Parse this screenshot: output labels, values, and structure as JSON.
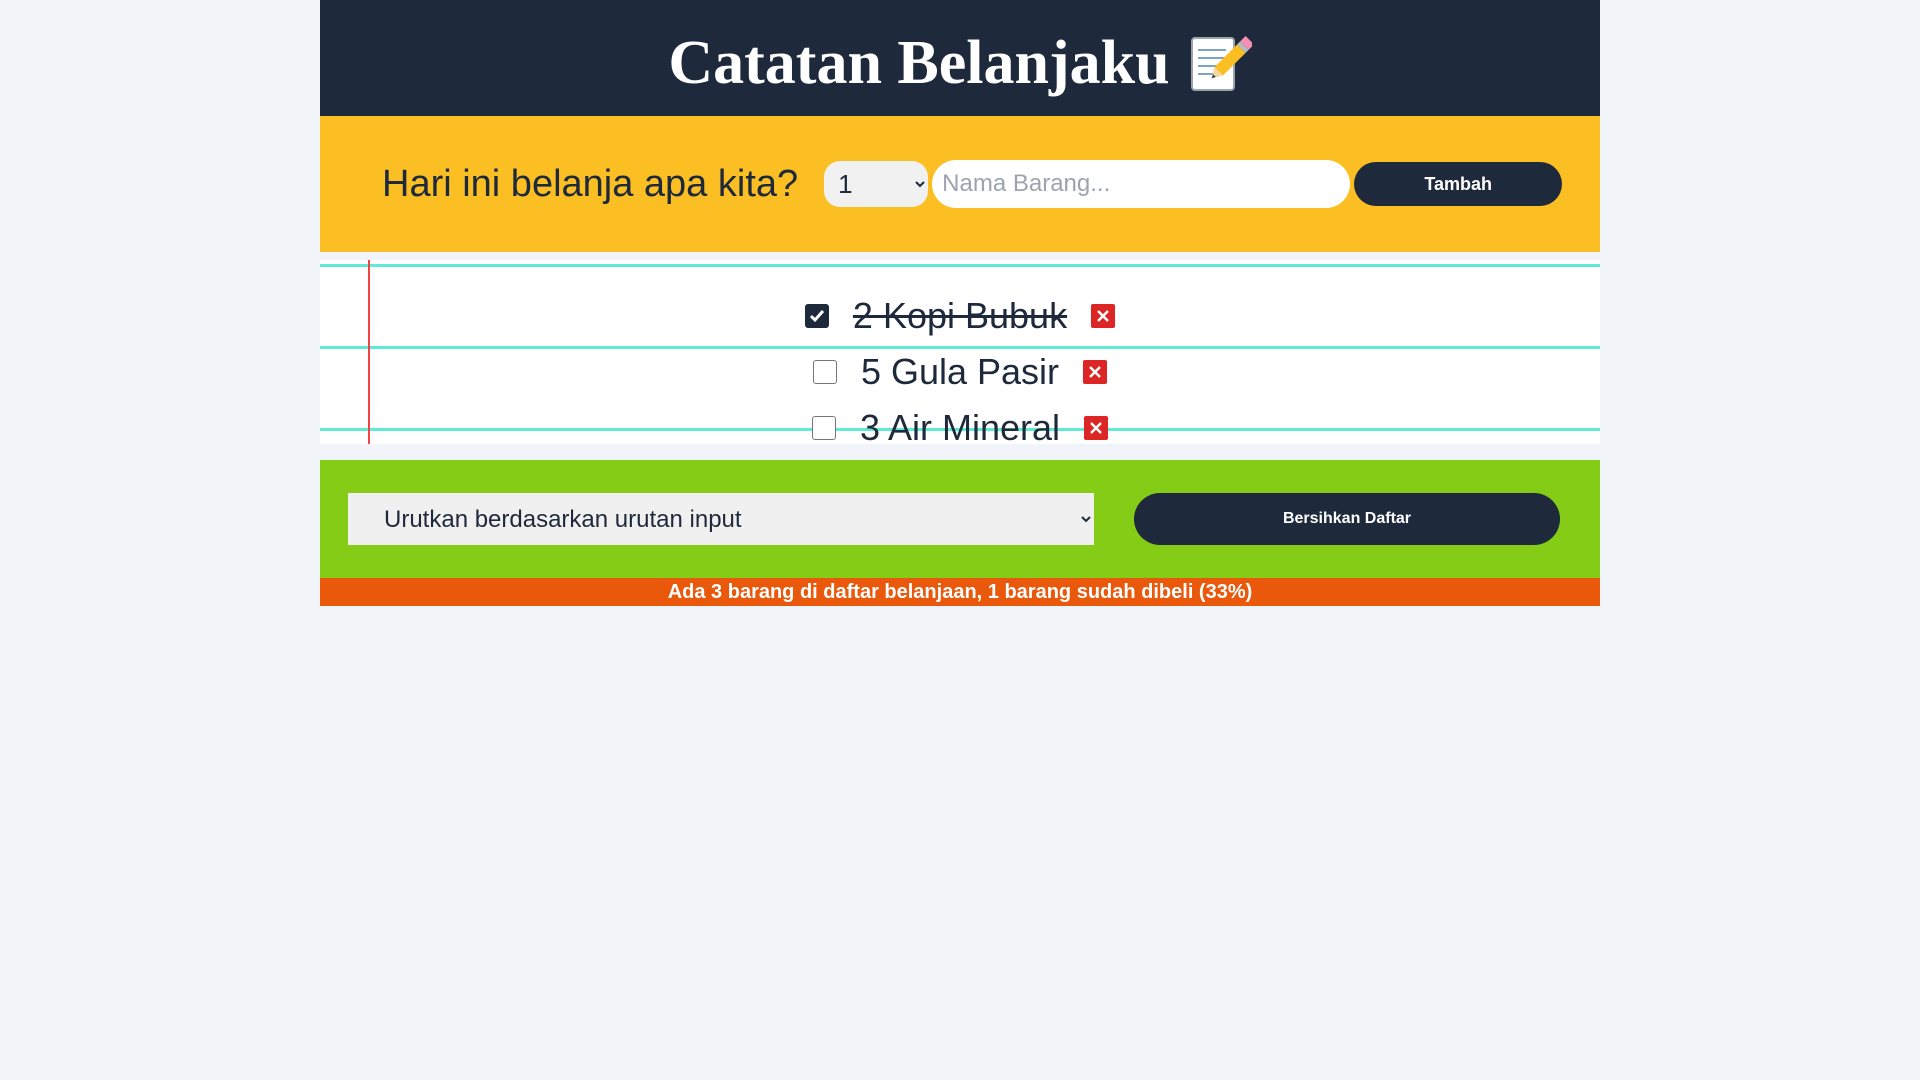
{
  "header": {
    "title": "Catatan Belanjaku",
    "emoji_icon": "memo-pencil-icon"
  },
  "form": {
    "question": "Hari ini belanja apa kita?",
    "quantity_selected": "1",
    "name_placeholder": "Nama Barang...",
    "add_label": "Tambah"
  },
  "items": [
    {
      "quantity": "2",
      "name": "Kopi Bubuk",
      "text": "2 Kopi Bubuk",
      "checked": true
    },
    {
      "quantity": "5",
      "name": "Gula Pasir",
      "text": "5 Gula Pasir",
      "checked": false
    },
    {
      "quantity": "3",
      "name": "Air Mineral",
      "text": "3 Air Mineral",
      "checked": false
    }
  ],
  "controls": {
    "sort_selected": "Urutkan berdasarkan urutan input",
    "clear_label": "Bersihkan Daftar"
  },
  "stats": {
    "text": "Ada 3 barang di daftar belanjaan, 1 barang sudah dibeli (33%)"
  },
  "colors": {
    "header_bg": "#1e293b",
    "form_bg": "#fbbf24",
    "controls_bg": "#84cc16",
    "stats_bg": "#ea580c",
    "delete_red": "#dc2626",
    "page_bg": "#f1f4f9"
  }
}
